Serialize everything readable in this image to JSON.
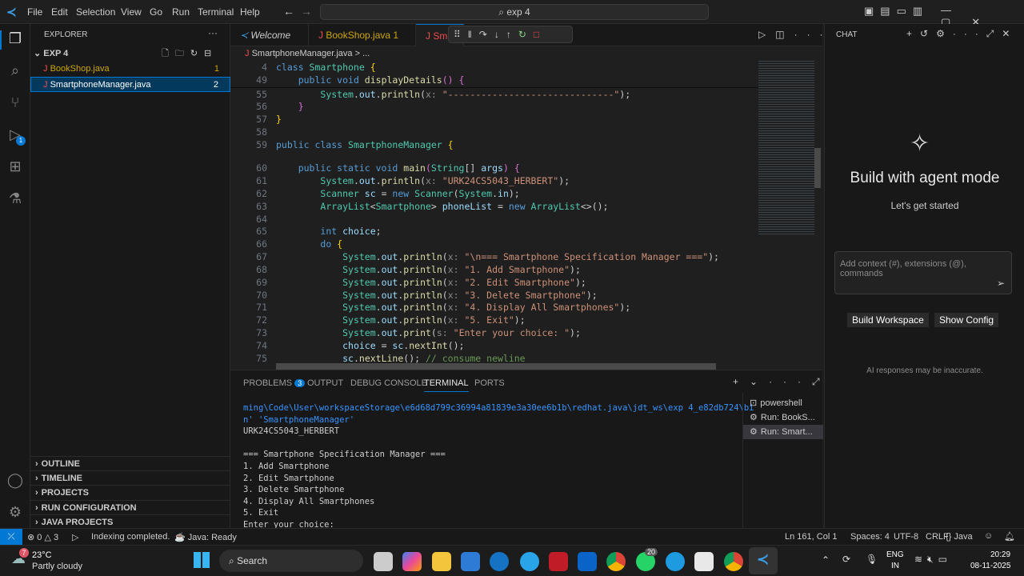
{
  "menu": [
    "File",
    "Edit",
    "Selection",
    "View",
    "Go",
    "Run",
    "Terminal",
    "Help"
  ],
  "search": "exp 4",
  "explorer": {
    "title": "EXPLORER",
    "folder": "EXP 4",
    "files": [
      {
        "name": "BookShop.java",
        "badge": "1"
      },
      {
        "name": "SmartphoneManager.java",
        "badge": "2"
      }
    ],
    "sections": [
      "OUTLINE",
      "TIMELINE",
      "PROJECTS",
      "RUN CONFIGURATION",
      "JAVA PROJECTS"
    ]
  },
  "activity_badge": "1",
  "tabs": [
    {
      "label": "Welcome"
    },
    {
      "label": "BookShop.java 1"
    },
    {
      "label": "Sm"
    }
  ],
  "breadcrumb": {
    "file": "SmartphoneManager.java",
    "rest": "> ..."
  },
  "code": [
    {
      "n": "4",
      "t": [
        [
          "kw",
          "class "
        ],
        [
          "cls",
          "Smartphone "
        ],
        [
          "br",
          "{"
        ]
      ]
    },
    {
      "n": "49",
      "t": [
        [
          "pl",
          "    "
        ],
        [
          "kw",
          "public void "
        ],
        [
          "fn",
          "displayDetails"
        ],
        [
          "br2",
          "()"
        ],
        [
          "pl",
          " "
        ],
        [
          "br2",
          "{"
        ]
      ]
    },
    {
      "n": "55",
      "t": [
        [
          "pl",
          "        "
        ],
        [
          "cls",
          "System"
        ],
        [
          "pl",
          "."
        ],
        [
          "var",
          "out"
        ],
        [
          "pl",
          "."
        ],
        [
          "fn",
          "println"
        ],
        [
          "pl",
          "("
        ],
        [
          "hint",
          "x: "
        ],
        [
          "str",
          "\"------------------------------\""
        ],
        [
          "pl",
          ");"
        ]
      ]
    },
    {
      "n": "56",
      "t": [
        [
          "pl",
          "    "
        ],
        [
          "br2",
          "}"
        ]
      ]
    },
    {
      "n": "57",
      "t": [
        [
          "br",
          "}"
        ]
      ]
    },
    {
      "n": "58",
      "t": []
    },
    {
      "n": "59",
      "t": [
        [
          "kw",
          "public class "
        ],
        [
          "cls",
          "SmartphoneManager "
        ],
        [
          "br",
          "{"
        ]
      ]
    },
    {
      "n": "60",
      "t": [
        [
          "pl",
          "    "
        ],
        [
          "kw",
          "public static void "
        ],
        [
          "fn",
          "main"
        ],
        [
          "br2",
          "("
        ],
        [
          "cls",
          "String"
        ],
        [
          "pl",
          "[] "
        ],
        [
          "var",
          "args"
        ],
        [
          "br2",
          ")"
        ],
        [
          "pl",
          " "
        ],
        [
          "br2",
          "{"
        ]
      ]
    },
    {
      "n": "61",
      "t": [
        [
          "pl",
          "        "
        ],
        [
          "cls",
          "System"
        ],
        [
          "pl",
          "."
        ],
        [
          "var",
          "out"
        ],
        [
          "pl",
          "."
        ],
        [
          "fn",
          "println"
        ],
        [
          "pl",
          "("
        ],
        [
          "hint",
          "x: "
        ],
        [
          "str",
          "\"URK24CS5043_HERBERT\""
        ],
        [
          "pl",
          ");"
        ]
      ]
    },
    {
      "n": "62",
      "t": [
        [
          "pl",
          "        "
        ],
        [
          "cls",
          "Scanner "
        ],
        [
          "var",
          "sc"
        ],
        [
          "pl",
          " = "
        ],
        [
          "kw",
          "new "
        ],
        [
          "cls",
          "Scanner"
        ],
        [
          "pl",
          "("
        ],
        [
          "cls",
          "System"
        ],
        [
          "pl",
          "."
        ],
        [
          "var",
          "in"
        ],
        [
          "pl",
          ");"
        ]
      ]
    },
    {
      "n": "63",
      "t": [
        [
          "pl",
          "        "
        ],
        [
          "cls",
          "ArrayList"
        ],
        [
          "pl",
          "<"
        ],
        [
          "cls",
          "Smartphone"
        ],
        [
          "pl",
          "> "
        ],
        [
          "var",
          "phoneList"
        ],
        [
          "pl",
          " = "
        ],
        [
          "kw",
          "new "
        ],
        [
          "cls",
          "ArrayList"
        ],
        [
          "pl",
          "<>();"
        ]
      ]
    },
    {
      "n": "64",
      "t": []
    },
    {
      "n": "65",
      "t": [
        [
          "pl",
          "        "
        ],
        [
          "kw",
          "int "
        ],
        [
          "var",
          "choice"
        ],
        [
          "pl",
          ";"
        ]
      ]
    },
    {
      "n": "66",
      "t": [
        [
          "pl",
          "        "
        ],
        [
          "kw",
          "do "
        ],
        [
          "br",
          "{"
        ]
      ]
    },
    {
      "n": "67",
      "t": [
        [
          "pl",
          "            "
        ],
        [
          "cls",
          "System"
        ],
        [
          "pl",
          "."
        ],
        [
          "var",
          "out"
        ],
        [
          "pl",
          "."
        ],
        [
          "fn",
          "println"
        ],
        [
          "pl",
          "("
        ],
        [
          "hint",
          "x: "
        ],
        [
          "str",
          "\"\\n=== Smartphone Specification Manager ===\""
        ],
        [
          "pl",
          ");"
        ]
      ]
    },
    {
      "n": "68",
      "t": [
        [
          "pl",
          "            "
        ],
        [
          "cls",
          "System"
        ],
        [
          "pl",
          "."
        ],
        [
          "var",
          "out"
        ],
        [
          "pl",
          "."
        ],
        [
          "fn",
          "println"
        ],
        [
          "pl",
          "("
        ],
        [
          "hint",
          "x: "
        ],
        [
          "str",
          "\"1. Add Smartphone\""
        ],
        [
          "pl",
          ");"
        ]
      ]
    },
    {
      "n": "69",
      "t": [
        [
          "pl",
          "            "
        ],
        [
          "cls",
          "System"
        ],
        [
          "pl",
          "."
        ],
        [
          "var",
          "out"
        ],
        [
          "pl",
          "."
        ],
        [
          "fn",
          "println"
        ],
        [
          "pl",
          "("
        ],
        [
          "hint",
          "x: "
        ],
        [
          "str",
          "\"2. Edit Smartphone\""
        ],
        [
          "pl",
          ");"
        ]
      ]
    },
    {
      "n": "70",
      "t": [
        [
          "pl",
          "            "
        ],
        [
          "cls",
          "System"
        ],
        [
          "pl",
          "."
        ],
        [
          "var",
          "out"
        ],
        [
          "pl",
          "."
        ],
        [
          "fn",
          "println"
        ],
        [
          "pl",
          "("
        ],
        [
          "hint",
          "x: "
        ],
        [
          "str",
          "\"3. Delete Smartphone\""
        ],
        [
          "pl",
          ");"
        ]
      ]
    },
    {
      "n": "71",
      "t": [
        [
          "pl",
          "            "
        ],
        [
          "cls",
          "System"
        ],
        [
          "pl",
          "."
        ],
        [
          "var",
          "out"
        ],
        [
          "pl",
          "."
        ],
        [
          "fn",
          "println"
        ],
        [
          "pl",
          "("
        ],
        [
          "hint",
          "x: "
        ],
        [
          "str",
          "\"4. Display All Smartphones\""
        ],
        [
          "pl",
          ");"
        ]
      ]
    },
    {
      "n": "72",
      "t": [
        [
          "pl",
          "            "
        ],
        [
          "cls",
          "System"
        ],
        [
          "pl",
          "."
        ],
        [
          "var",
          "out"
        ],
        [
          "pl",
          "."
        ],
        [
          "fn",
          "println"
        ],
        [
          "pl",
          "("
        ],
        [
          "hint",
          "x: "
        ],
        [
          "str",
          "\"5. Exit\""
        ],
        [
          "pl",
          ");"
        ]
      ]
    },
    {
      "n": "73",
      "t": [
        [
          "pl",
          "            "
        ],
        [
          "cls",
          "System"
        ],
        [
          "pl",
          "."
        ],
        [
          "var",
          "out"
        ],
        [
          "pl",
          "."
        ],
        [
          "fn",
          "print"
        ],
        [
          "pl",
          "("
        ],
        [
          "hint",
          "s: "
        ],
        [
          "str",
          "\"Enter your choice: \""
        ],
        [
          "pl",
          ");"
        ]
      ]
    },
    {
      "n": "74",
      "t": [
        [
          "pl",
          "            "
        ],
        [
          "var",
          "choice"
        ],
        [
          "pl",
          " = "
        ],
        [
          "var",
          "sc"
        ],
        [
          "pl",
          "."
        ],
        [
          "fn",
          "nextInt"
        ],
        [
          "pl",
          "();"
        ]
      ]
    },
    {
      "n": "75",
      "t": [
        [
          "pl",
          "            "
        ],
        [
          "var",
          "sc"
        ],
        [
          "pl",
          "."
        ],
        [
          "fn",
          "nextLine"
        ],
        [
          "pl",
          "(); "
        ],
        [
          "cm",
          "// consume newline"
        ]
      ]
    }
  ],
  "panel": {
    "tabs": [
      "PROBLEMS",
      "OUTPUT",
      "DEBUG CONSOLE",
      "TERMINAL",
      "PORTS"
    ],
    "problems_badge": "3",
    "terminal": [
      "ming\\Code\\User\\workspaceStorage\\e6d68d799c36994a81839e3a30ee6b1b\\redhat.java\\jdt_ws\\exp 4_e82db724\\bi",
      "n' 'SmartphoneManager'",
      "URK24CS5043_HERBERT",
      "",
      "=== Smartphone Specification Manager ===",
      "1. Add Smartphone",
      "2. Edit Smartphone",
      "3. Delete Smartphone",
      "4. Display All Smartphones",
      "5. Exit",
      "Enter your choice:"
    ],
    "sessions": [
      "powershell",
      "Run: BookS...",
      "Run: Smart..."
    ]
  },
  "chat": {
    "title": "CHAT",
    "heading": "Build with agent mode",
    "sub": "Let's get started",
    "placeholder": "Add context (#), extensions (@), commands",
    "btn1": "Build Workspace",
    "btn2": "Show Config",
    "note": "AI responses may be inaccurate."
  },
  "status": {
    "errors": "0",
    "warnings": "3",
    "indexing": "Indexing completed.",
    "java": "Java: Ready",
    "pos": "Ln 161, Col 1",
    "spaces": "Spaces: 4",
    "enc": "UTF-8",
    "eol": "CRLF",
    "lang": "Java"
  },
  "taskbar": {
    "temp": "23°C",
    "weather": "Partly cloudy",
    "weather_badge": "7",
    "search": "Search",
    "whatsapp_badge": "20",
    "lang1": "ENG",
    "lang2": "IN",
    "time": "20:29",
    "date": "08-11-2025"
  },
  "colors": {
    "accent": "#0078d4",
    "selected": "#04395e"
  }
}
